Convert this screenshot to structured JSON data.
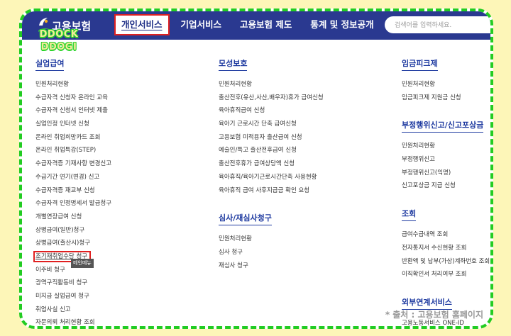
{
  "header": {
    "logo_text": "고용보험",
    "nav": [
      "개인서비스",
      "기업서비스",
      "고용보험 제도",
      "통계 및 정보공개"
    ],
    "active_index": 0,
    "search_placeholder": "검색어를 입력하세요."
  },
  "watermark": [
    "DDOCK",
    "DDOGI"
  ],
  "columns": [
    {
      "sections": [
        {
          "title": "실업급여",
          "items": [
            "민원처리현황",
            "수급자격 신청자 온라인 교육",
            "수급자격 신청서 인터넷 제출",
            "실업인정 인터넷 신청",
            "온라인 취업희망카드 조회",
            "온라인 취업특강(STEP)",
            "수급자격증 기재사항 변경신고",
            "수급기간 연기(변경) 신고",
            "수급자격증 재교부 신청",
            "수급자격 인정명세서 발급청구",
            "개별연장급여 신청",
            "상병급여(일반)청구",
            "상병급여(출산시)청구",
            "조기재취업수당 청구",
            "이주비 청구",
            "광역구직활동비 청구",
            "미지급 실업급여 청구",
            "취업사실 신고",
            "자문의뢰 처리현황 조회"
          ],
          "highlight_index": 13,
          "tooltip": "메인메뉴"
        }
      ]
    },
    {
      "sections": [
        {
          "title": "모성보호",
          "items": [
            "민원처리현황",
            "출산전후(유산,사산,배우자)휴가 급여신청",
            "육아휴직급여 신청",
            "육아기 근로시간 단축 급여신청",
            "고용보험 미적용자 출산급여 신청",
            "예술인/특고 출산전후급여 신청",
            "출산전후휴가 급여상당액 신청",
            "육아휴직/육아기근로시간단축 사용현황",
            "육아휴직 급여 사후지급금 확인 요청"
          ]
        },
        {
          "title": "심사/재심사청구",
          "items": [
            "민원처리현황",
            "심사 청구",
            "재심사 청구"
          ]
        }
      ]
    },
    {
      "sections": [
        {
          "title": "임금피크제",
          "items": [
            "민원처리현황",
            "임금피크제 지원금 신청"
          ]
        },
        {
          "title": "부정행위신고/신고포상금",
          "items": [
            "민원처리현황",
            "부정행위신고",
            "부정행위신고(익명)",
            "신고포상금 지급 신청"
          ]
        },
        {
          "title": "조회",
          "items": [
            "급여수급내역 조회",
            "전자통지서 수신현황 조회",
            "반환액 및 납부(가상)계좌번호 조회",
            "이직확인서 처리여부 조회"
          ]
        },
        {
          "title": "외부연계서비스",
          "items": [
            "고용노동서비스 ONE-ID"
          ]
        }
      ]
    }
  ],
  "caption": "* 출처 : 고용보험 홈페이지"
}
